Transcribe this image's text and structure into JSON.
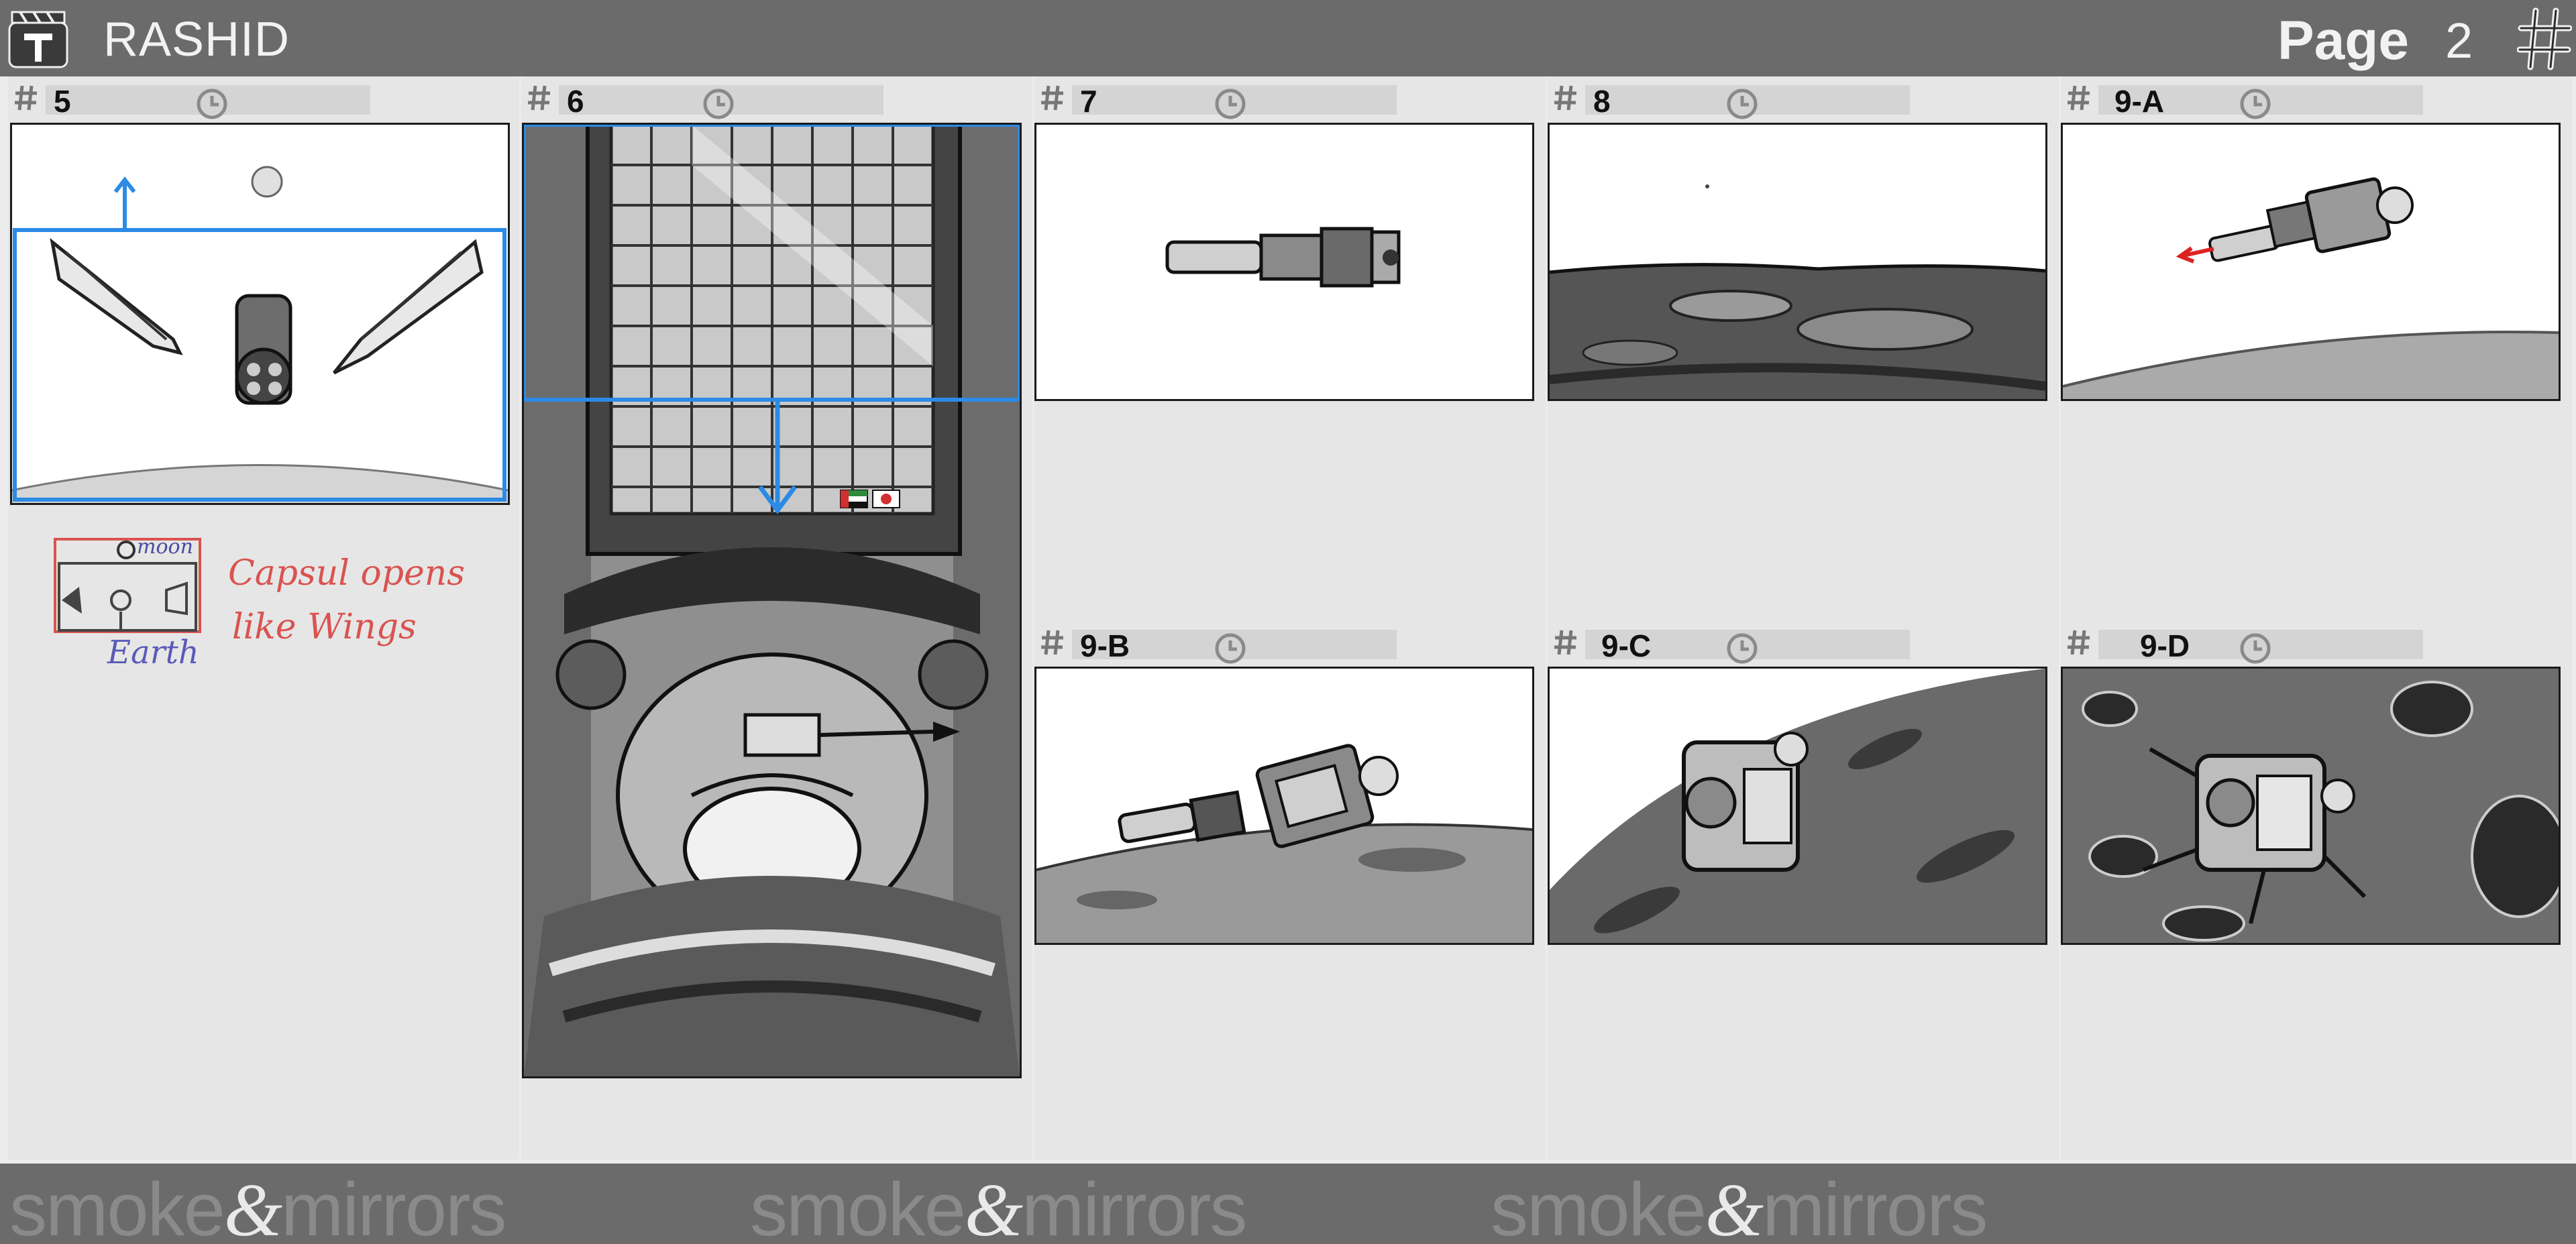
{
  "header": {
    "title": "RASHID",
    "page_label": "Page",
    "page_number": "2",
    "logo_icon": "clapperboard-t-icon",
    "menu_icon": "hash-icon",
    "bg_color": "#6b6b6b"
  },
  "panels": [
    {
      "number": "5"
    },
    {
      "number": "6"
    },
    {
      "number": "7"
    },
    {
      "number": "8"
    },
    {
      "number": "9-A"
    },
    {
      "number": "9-B"
    },
    {
      "number": "9-C"
    },
    {
      "number": "9-D"
    }
  ],
  "annotations": {
    "sketch_moon": "moon",
    "sketch_earth": "Earth",
    "note_line1": "Capsul opens",
    "note_line2": "like Wings",
    "accent_blue": "#2b8be6",
    "note_red": "#d9534f"
  },
  "footer": {
    "brand_left": "smoke",
    "brand_amp": "&",
    "brand_right": "mirrors"
  }
}
